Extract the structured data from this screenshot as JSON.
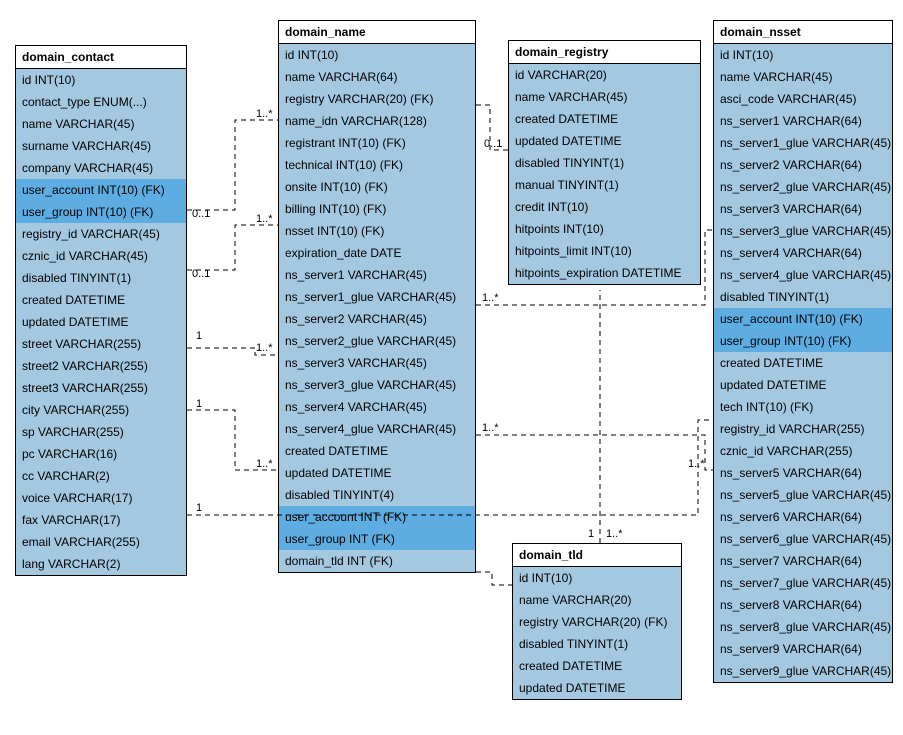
{
  "diagram_type": "entity-relationship",
  "entities": {
    "domain_contact": {
      "title": "domain_contact",
      "columns": [
        {
          "text": "id INT(10)"
        },
        {
          "text": "contact_type ENUM(...)"
        },
        {
          "text": "name VARCHAR(45)"
        },
        {
          "text": "surname VARCHAR(45)"
        },
        {
          "text": "company VARCHAR(45)"
        },
        {
          "text": "user_account INT(10) (FK)",
          "hl": true
        },
        {
          "text": "user_group INT(10) (FK)",
          "hl": true
        },
        {
          "text": "registry_id VARCHAR(45)"
        },
        {
          "text": "cznic_id VARCHAR(45)"
        },
        {
          "text": "disabled TINYINT(1)"
        },
        {
          "text": "created DATETIME"
        },
        {
          "text": "updated DATETIME"
        },
        {
          "text": "street VARCHAR(255)"
        },
        {
          "text": "street2 VARCHAR(255)"
        },
        {
          "text": "street3 VARCHAR(255)"
        },
        {
          "text": "city VARCHAR(255)"
        },
        {
          "text": "sp VARCHAR(255)"
        },
        {
          "text": "pc VARCHAR(16)"
        },
        {
          "text": "cc VARCHAR(2)"
        },
        {
          "text": "voice VARCHAR(17)"
        },
        {
          "text": "fax VARCHAR(17)"
        },
        {
          "text": "email VARCHAR(255)"
        },
        {
          "text": "lang VARCHAR(2)"
        }
      ]
    },
    "domain_name": {
      "title": "domain_name",
      "columns": [
        {
          "text": "id INT(10)"
        },
        {
          "text": "name VARCHAR(64)"
        },
        {
          "text": "registry VARCHAR(20) (FK)"
        },
        {
          "text": "name_idn VARCHAR(128)"
        },
        {
          "text": "registrant INT(10) (FK)"
        },
        {
          "text": "technical INT(10) (FK)"
        },
        {
          "text": "onsite INT(10) (FK)"
        },
        {
          "text": "billing INT(10) (FK)"
        },
        {
          "text": "nsset INT(10) (FK)"
        },
        {
          "text": "expiration_date DATE"
        },
        {
          "text": "ns_server1 VARCHAR(45)"
        },
        {
          "text": "ns_server1_glue VARCHAR(45)"
        },
        {
          "text": "ns_server2 VARCHAR(45)"
        },
        {
          "text": "ns_server2_glue VARCHAR(45)"
        },
        {
          "text": "ns_server3 VARCHAR(45)"
        },
        {
          "text": "ns_server3_glue VARCHAR(45)"
        },
        {
          "text": "ns_server4 VARCHAR(45)"
        },
        {
          "text": "ns_server4_glue VARCHAR(45)"
        },
        {
          "text": "created DATETIME"
        },
        {
          "text": "updated DATETIME"
        },
        {
          "text": "disabled TINYINT(4)"
        },
        {
          "text": "user_account INT (FK)",
          "hl": true
        },
        {
          "text": "user_group INT (FK)",
          "hl": true
        },
        {
          "text": "domain_tld INT (FK)"
        }
      ]
    },
    "domain_registry": {
      "title": "domain_registry",
      "columns": [
        {
          "text": "id VARCHAR(20)"
        },
        {
          "text": "name VARCHAR(45)"
        },
        {
          "text": "created DATETIME"
        },
        {
          "text": "updated DATETIME"
        },
        {
          "text": "disabled TINYINT(1)"
        },
        {
          "text": "manual TINYINT(1)"
        },
        {
          "text": "credit INT(10)"
        },
        {
          "text": "hitpoints INT(10)"
        },
        {
          "text": "hitpoints_limit INT(10)"
        },
        {
          "text": "hitpoints_expiration DATETIME"
        }
      ]
    },
    "domain_tld": {
      "title": "domain_tld",
      "columns": [
        {
          "text": "id INT(10)"
        },
        {
          "text": "name VARCHAR(20)"
        },
        {
          "text": "registry VARCHAR(20) (FK)"
        },
        {
          "text": "disabled TINYINT(1)"
        },
        {
          "text": "created DATETIME"
        },
        {
          "text": "updated DATETIME"
        }
      ]
    },
    "domain_nsset": {
      "title": "domain_nsset",
      "columns": [
        {
          "text": "id INT(10)"
        },
        {
          "text": "name VARCHAR(45)"
        },
        {
          "text": "asci_code VARCHAR(45)"
        },
        {
          "text": "ns_server1 VARCHAR(64)"
        },
        {
          "text": "ns_server1_glue VARCHAR(45)"
        },
        {
          "text": "ns_server2 VARCHAR(64)"
        },
        {
          "text": "ns_server2_glue VARCHAR(45)"
        },
        {
          "text": "ns_server3 VARCHAR(64)"
        },
        {
          "text": "ns_server3_glue VARCHAR(45)"
        },
        {
          "text": "ns_server4 VARCHAR(64)"
        },
        {
          "text": "ns_server4_glue VARCHAR(45)"
        },
        {
          "text": "disabled TINYINT(1)"
        },
        {
          "text": "user_account INT(10) (FK)",
          "hl": true
        },
        {
          "text": "user_group INT(10) (FK)",
          "hl": true
        },
        {
          "text": "created DATETIME"
        },
        {
          "text": "updated DATETIME"
        },
        {
          "text": "tech INT(10) (FK)"
        },
        {
          "text": "registry_id VARCHAR(255)"
        },
        {
          "text": "cznic_id VARCHAR(255)"
        },
        {
          "text": "ns_server5 VARCHAR(64)"
        },
        {
          "text": "ns_server5_glue VARCHAR(45)"
        },
        {
          "text": "ns_server6 VARCHAR(64)"
        },
        {
          "text": "ns_server6_glue VARCHAR(45)"
        },
        {
          "text": "ns_server7 VARCHAR(64)"
        },
        {
          "text": "ns_server7_glue VARCHAR(45)"
        },
        {
          "text": "ns_server8 VARCHAR(64)"
        },
        {
          "text": "ns_server8_glue VARCHAR(45)"
        },
        {
          "text": "ns_server9 VARCHAR(64)"
        },
        {
          "text": "ns_server9_glue VARCHAR(45)"
        }
      ]
    }
  },
  "relationships": [
    {
      "from": "domain_contact",
      "to": "domain_name.registrant",
      "card_left": "0..1",
      "card_right": "1..*"
    },
    {
      "from": "domain_contact",
      "to": "domain_name.billing",
      "card_left": "0..1",
      "card_right": "1..*"
    },
    {
      "from": "domain_contact",
      "to": "domain_name.technical",
      "card_left": "0..1",
      "card_right": "1..*"
    },
    {
      "from": "domain_contact",
      "to": "domain_name.onsite",
      "card_left": "1",
      "card_right": "1..*"
    },
    {
      "from": "domain_contact",
      "to": "domain_nsset.tech",
      "card_left": "1",
      "card_right": "1..*"
    },
    {
      "from": "domain_name.registry",
      "to": "domain_registry",
      "card_left": "0..1",
      "card_right": ""
    },
    {
      "from": "domain_name.nsset",
      "to": "domain_nsset",
      "card_left": "1..*",
      "card_right": ""
    },
    {
      "from": "domain_name.domain_tld",
      "to": "domain_tld",
      "card_left": "1..*",
      "card_right": "1"
    },
    {
      "from": "domain_tld.registry",
      "to": "domain_registry",
      "card_left": "1..*",
      "card_right": ""
    },
    {
      "from": "domain_nsset",
      "to": "domain_name",
      "card_left": "1..*",
      "card_right": ""
    }
  ],
  "cardinality_labels": {
    "L1": "1..*",
    "L2": "0..1",
    "L3": "1..*",
    "L4": "0..1",
    "L5": "1",
    "L6": "1..*",
    "L7": "1",
    "L8": "1..*",
    "L9": "1",
    "L10": "0..1",
    "L11": "1..*",
    "L12": "1..*",
    "L13": "1",
    "L14": "1..*",
    "L15": "1..*"
  }
}
